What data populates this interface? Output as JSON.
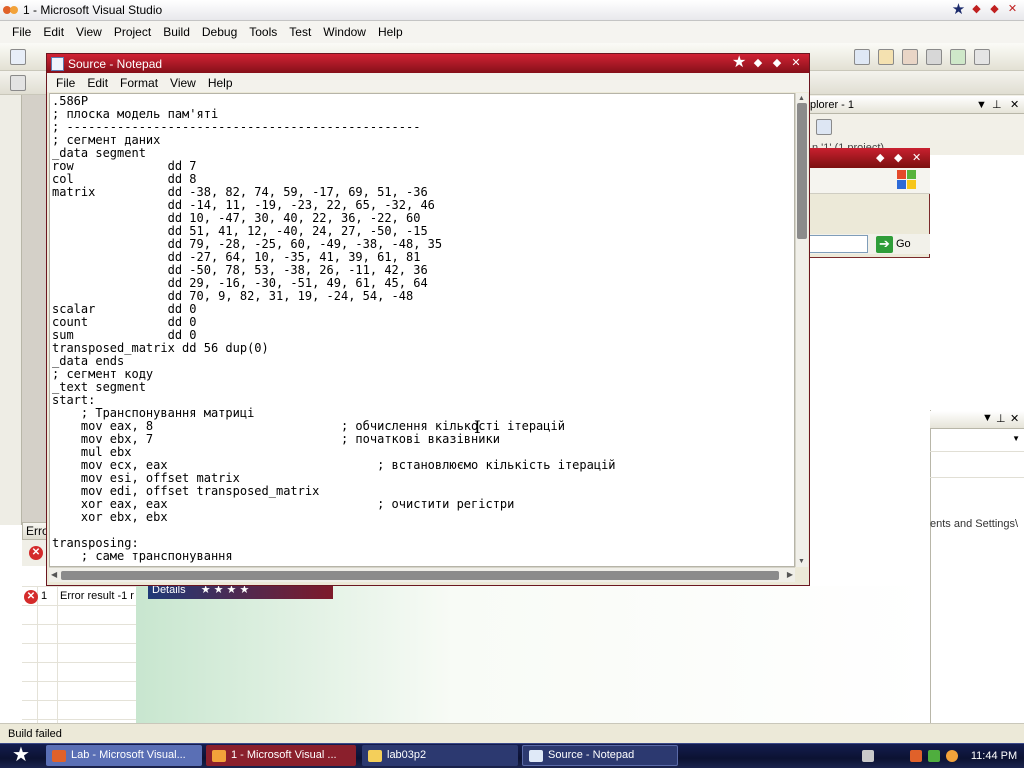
{
  "vs": {
    "title": "1 - Microsoft Visual Studio",
    "menu": [
      "File",
      "Edit",
      "View",
      "Project",
      "Build",
      "Debug",
      "Tools",
      "Test",
      "Window",
      "Help"
    ],
    "status": "Build failed"
  },
  "solution_explorer": {
    "title": "plorer - 1",
    "subtitle": "n '1' (1 project)"
  },
  "ie": {
    "go_label": "Go"
  },
  "properties_panel": {
    "path_text": "ents and Settings\\"
  },
  "error_list": {
    "title": "Error",
    "rows": [
      {
        "num": "1",
        "text": "Error result -1 r"
      }
    ],
    "details_tab": "Details"
  },
  "notepad": {
    "title": "Source - Notepad",
    "menu": [
      "File",
      "Edit",
      "Format",
      "View",
      "Help"
    ],
    "lines": [
      ".586P",
      "; плоска модель пам'яті",
      "; -------------------------------------------------",
      "; сегмент даних",
      "_data segment",
      "row             dd 7",
      "col             dd 8",
      "matrix          dd -38, 82, 74, 59, -17, 69, 51, -36",
      "                dd -14, 11, -19, -23, 22, 65, -32, 46",
      "                dd 10, -47, 30, 40, 22, 36, -22, 60",
      "                dd 51, 41, 12, -40, 24, 27, -50, -15",
      "                dd 79, -28, -25, 60, -49, -38, -48, 35",
      "                dd -27, 64, 10, -35, 41, 39, 61, 81",
      "                dd -50, 78, 53, -38, 26, -11, 42, 36",
      "                dd 29, -16, -30, -51, 49, 61, 45, 64",
      "                dd 70, 9, 82, 31, 19, -24, 54, -48",
      "scalar          dd 0",
      "count           dd 0",
      "sum             dd 0",
      "transposed_matrix dd 56 dup(0)",
      "_data ends",
      "; сегмент коду",
      "_text segment",
      "start:",
      "    ; Транспонування матриці",
      "    mov eax, 8                          ; обчислення кількості ітерацій",
      "    mov ebx, 7                          ; початкові вказівники",
      "    mul ebx",
      "    mov ecx, eax                             ; встановлюємо кількість ітерацій",
      "    mov esi, offset matrix",
      "    mov edi, offset transposed_matrix",
      "    xor eax, eax                             ; очистити регістри",
      "    xor ebx, ebx",
      "",
      "transposing:",
      "    ; саме транспонування"
    ]
  },
  "taskbar": {
    "buttons": [
      {
        "label": "Lab - Microsoft Visual...",
        "color": "#5a6fb5"
      },
      {
        "label": "1 - Microsoft Visual ...",
        "color": "#8a1f2c"
      },
      {
        "label": "lab03p2",
        "color": "#2c3970"
      },
      {
        "label": "Source - Notepad",
        "color": "#2c3970"
      }
    ],
    "clock": "11:44 PM"
  },
  "colors": {
    "title_red": "#b51a27",
    "taskbar_navy": "#0c1232",
    "go_green": "#2f9d39"
  }
}
